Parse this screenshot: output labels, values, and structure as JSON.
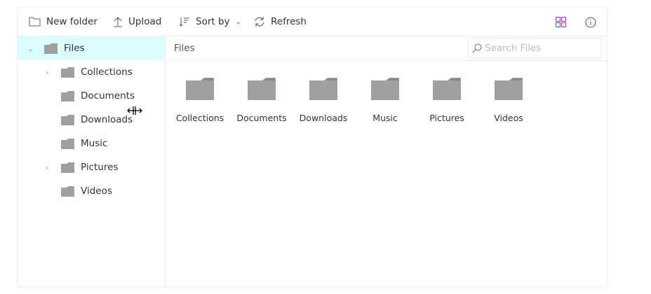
{
  "toolbar": {
    "new_folder": "New folder",
    "upload": "Upload",
    "sort_by": "Sort by",
    "refresh": "Refresh",
    "view_icon": "large-icons-view-icon",
    "details_icon": "info-icon"
  },
  "sidebar": {
    "root": "Files",
    "items": [
      {
        "label": "Collections",
        "expandable": true
      },
      {
        "label": "Documents",
        "expandable": false
      },
      {
        "label": "Downloads",
        "expandable": false
      },
      {
        "label": "Music",
        "expandable": false
      },
      {
        "label": "Pictures",
        "expandable": true
      },
      {
        "label": "Videos",
        "expandable": false
      }
    ]
  },
  "breadcrumb": "Files",
  "search": {
    "placeholder": "Search Files",
    "value": ""
  },
  "files": [
    "Collections",
    "Documents",
    "Downloads",
    "Music",
    "Pictures",
    "Videos"
  ],
  "colors": {
    "selected": "#dcfcff",
    "folder": "#a0a0a0"
  }
}
